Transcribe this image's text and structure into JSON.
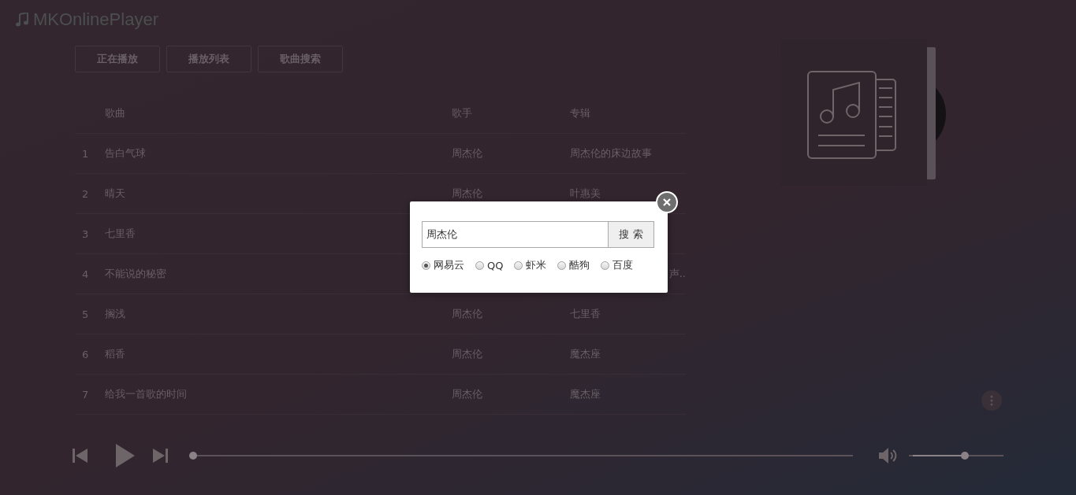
{
  "logo": {
    "title": "MKOnlinePlayer"
  },
  "tabs": [
    {
      "label": "正在播放"
    },
    {
      "label": "播放列表"
    },
    {
      "label": "歌曲搜索"
    }
  ],
  "table": {
    "columns": [
      "歌曲",
      "歌手",
      "专辑"
    ],
    "rows": [
      {
        "number": "1",
        "song": "告白气球",
        "singer": "周杰伦",
        "album": "周杰伦的床边故事"
      },
      {
        "number": "2",
        "song": "晴天",
        "singer": "周杰伦",
        "album": "叶惠美"
      },
      {
        "number": "3",
        "song": "七里香"
      },
      {
        "number": "4",
        "song": "不能说的秘密",
        "album": "声..",
        "album_clipped": true
      },
      {
        "number": "5",
        "song": "搁浅",
        "singer": "周杰伦",
        "album": "七里香"
      },
      {
        "number": "6",
        "song": "稻香",
        "singer": "周杰伦",
        "album": "魔杰座"
      },
      {
        "number": "7",
        "song": "给我一首歌的时间",
        "singer": "周杰伦",
        "album": "魔杰座"
      }
    ]
  },
  "player": {
    "progress": {
      "level": 0
    },
    "volume": {
      "level": 0.6
    }
  },
  "dialog": {
    "search": {
      "value": "周杰伦"
    },
    "button": "搜 索",
    "sources": [
      {
        "label": "网易云",
        "selected": true
      },
      {
        "label": "QQ",
        "selected": false
      },
      {
        "label": "虾米",
        "selected": false
      },
      {
        "label": "酷狗",
        "selected": false
      },
      {
        "label": "百度",
        "selected": false
      }
    ]
  }
}
